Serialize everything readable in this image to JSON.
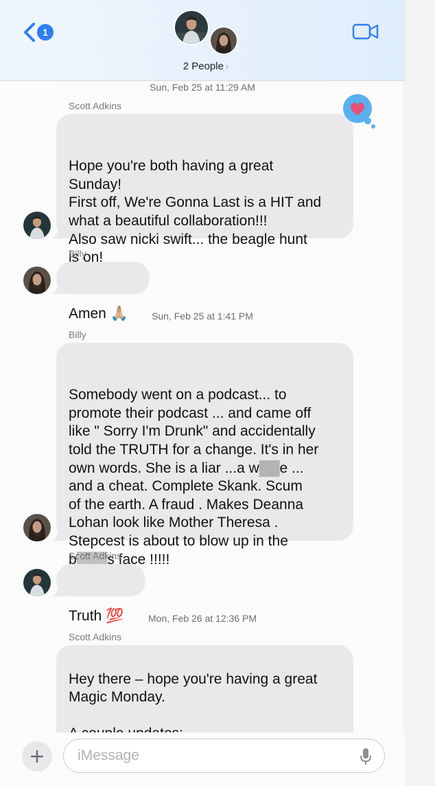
{
  "header": {
    "back_count": "1",
    "group_name": "2 People",
    "group_chevron": "›"
  },
  "messages": [
    {
      "timestamp": "Sun, Feb 25 at 11:29 AM"
    },
    {
      "sender": "Scott Adkins",
      "text": "Hope you're both having a great\nSunday!\nFirst off, We're Gonna Last is a HIT and\nwhat a beautiful collaboration!!!\nAlso saw nicki swift... the beagle hunt\nis on!",
      "reaction": "heart"
    },
    {
      "sender": "Billy",
      "text": "Amen 🙏🏼"
    },
    {
      "timestamp": "Sun, Feb 25 at 1:41 PM"
    },
    {
      "sender": "Billy",
      "text": "Somebody went on a podcast... to\npromote their podcast ... and came off\nlike \" Sorry I'm Drunk\" and accidentally\ntold the TRUTH for a change. It's in her\nown words.  She is a liar ...a w▒▒e ...\nand a cheat.   Complete Skank. Scum\nof the earth. A fraud . Makes Deanna\nLohan look like Mother Theresa .\nStepcest is about to blow up in the\nb▒▒▒s face !!!!!"
    },
    {
      "sender": "Scott Adkins",
      "text": "Truth 💯"
    },
    {
      "timestamp": "Mon, Feb 26 at 12:36 PM"
    },
    {
      "sender": "Scott Adkins",
      "text": "Hey there – hope you're having a great\nMagic Monday.\n\nA couple updates:"
    }
  ],
  "composer": {
    "placeholder": "iMessage"
  },
  "colors": {
    "accent": "#2f7ef1",
    "bubble_gray": "#e9e9eb",
    "reaction_blue": "#5ab0ef",
    "reaction_heart": "#e8507a"
  }
}
